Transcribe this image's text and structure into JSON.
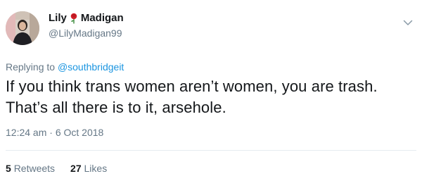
{
  "tweet": {
    "author": {
      "name_first": "Lily",
      "name_last": "Madigan",
      "emoji_icon": "rose-icon",
      "handle": "@LilyMadigan99"
    },
    "menu_icon": "chevron-down-icon",
    "replying_prefix": "Replying to",
    "replying_to": "@southbridgeit",
    "text_line1": "If you think trans women aren’t women, you are trash.",
    "text_line2": "That’s all there is to it, arsehole.",
    "timestamp": "12:24 am · 6 Oct 2018",
    "stats": {
      "retweets_count": "5",
      "retweets_label": "Retweets",
      "likes_count": "27",
      "likes_label": "Likes"
    },
    "colors": {
      "link": "#1b95e0",
      "secondary": "#657786",
      "primary": "#14171a",
      "divider": "#e6ecf0"
    }
  }
}
